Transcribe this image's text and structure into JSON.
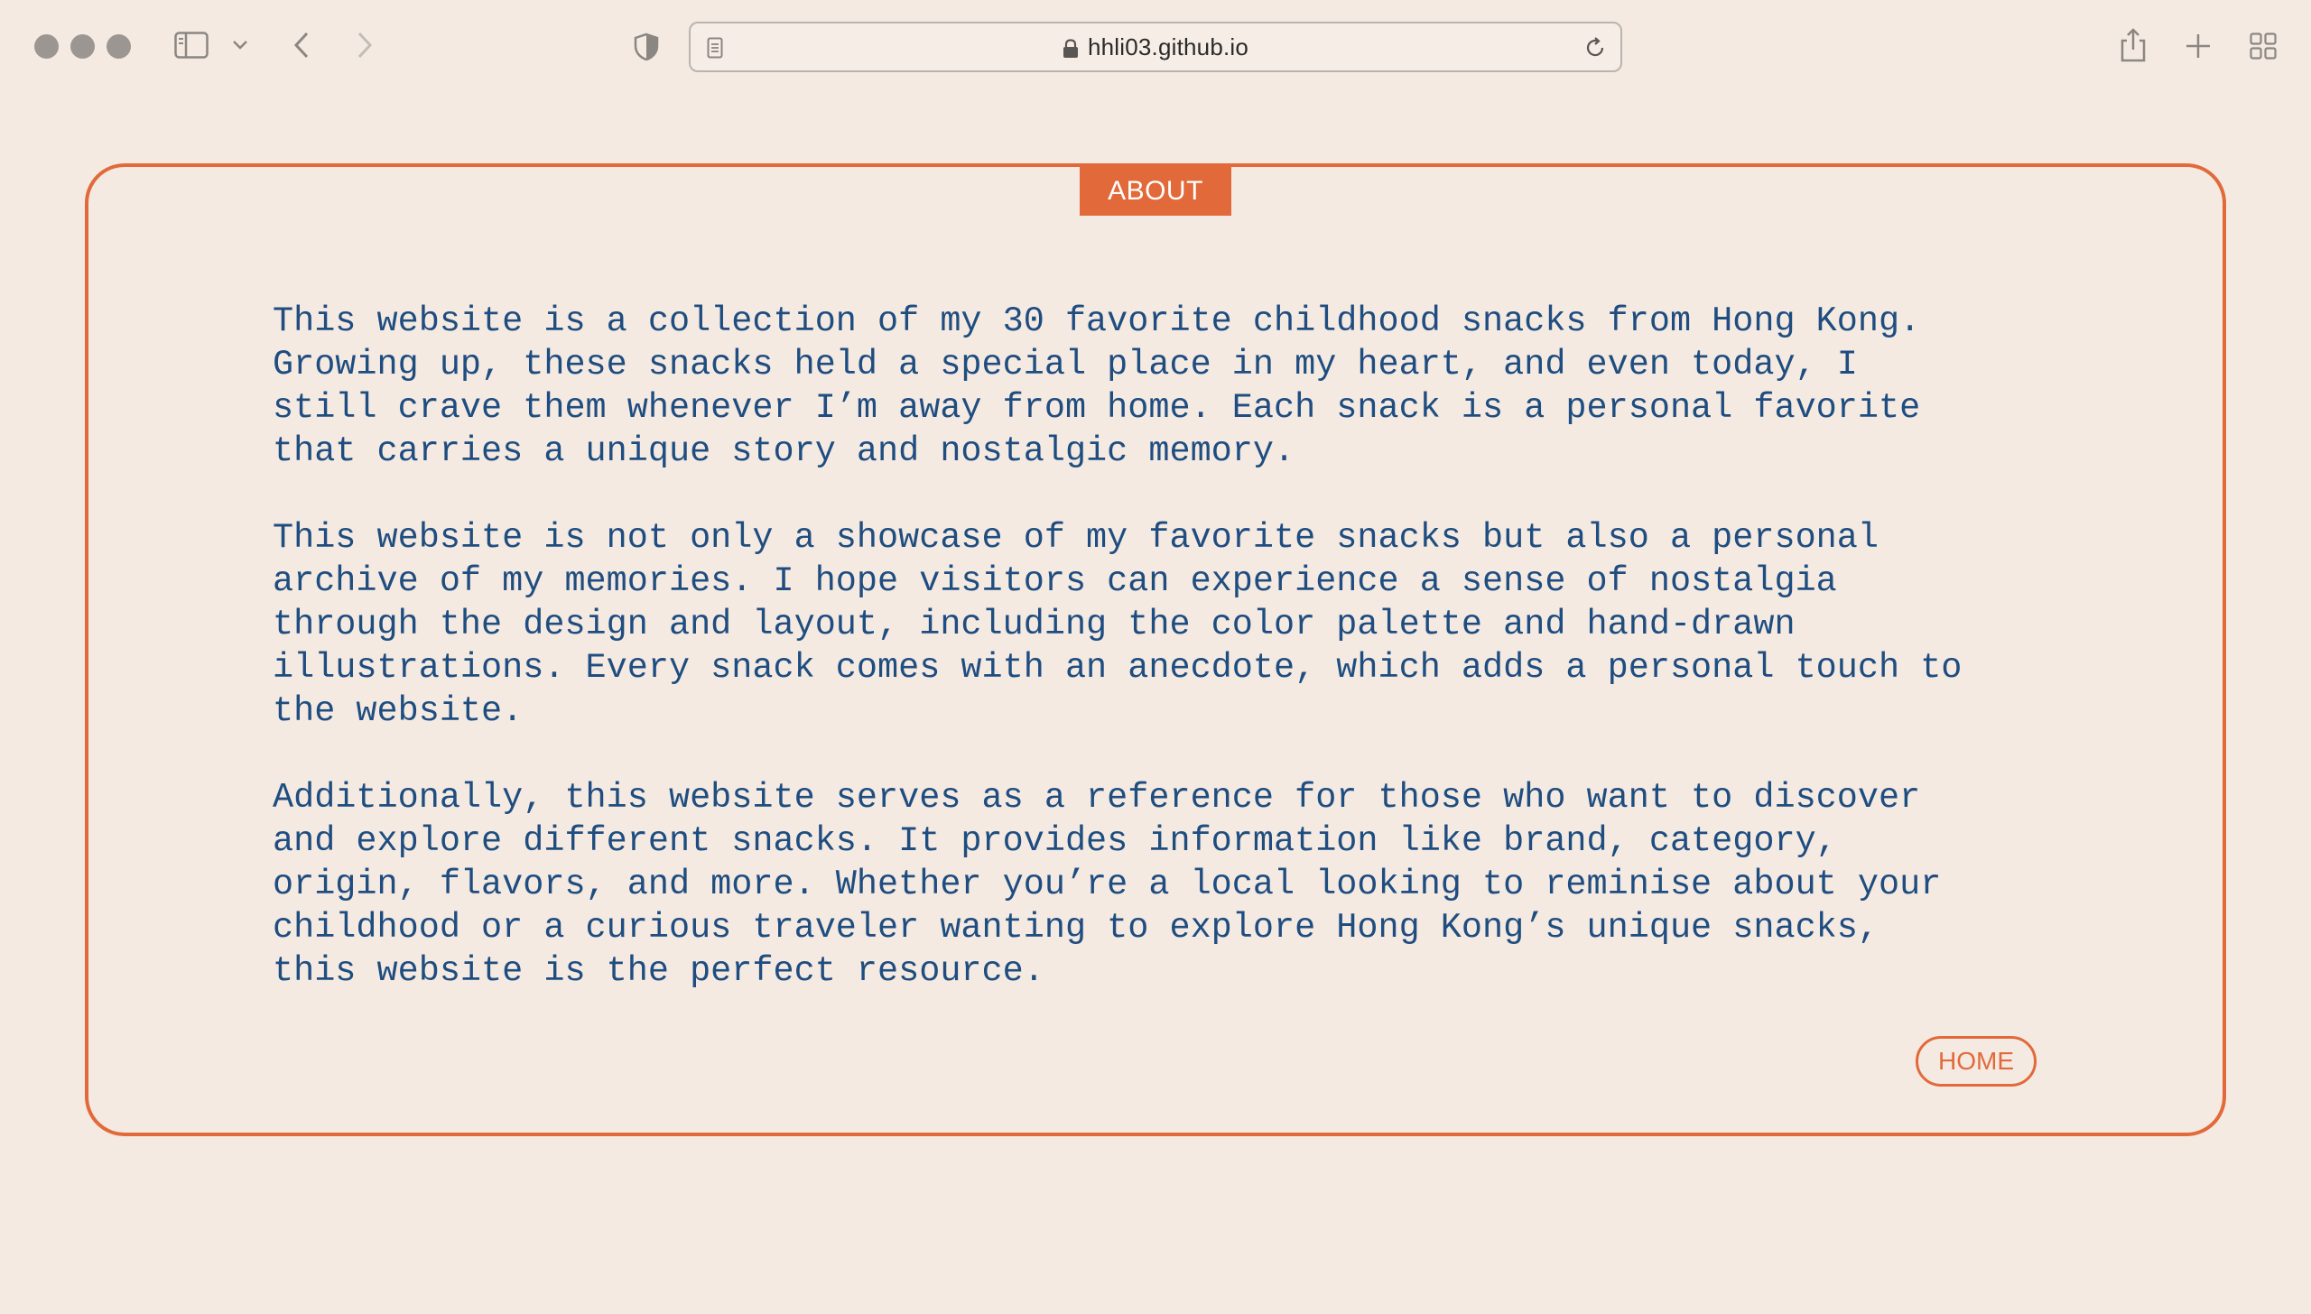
{
  "browser": {
    "url": "hhli03.github.io"
  },
  "page": {
    "section_tag": "ABOUT",
    "paragraphs": [
      "This website is a collection of my 30 favorite childhood snacks from Hong Kong.\nGrowing up, these snacks held a special place in my heart, and even today, I\nstill crave them whenever I’m away from home. Each snack is a personal favorite\nthat carries a unique story and nostalgic memory.",
      "This website is not only a showcase of my favorite snacks but also a personal\narchive of my memories. I hope visitors can experience a sense of nostalgia\nthrough the design and layout, including the color palette and hand-drawn\nillustrations. Every snack comes with an anecdote, which adds a personal touch to\nthe website.",
      "Additionally, this website serves as a reference for those who want to discover\nand explore different snacks. It provides information like brand, category,\norigin, flavors, and more. Whether you’re a local looking to reminise about your\nchildhood or a curious traveler wanting to explore Hong Kong’s unique snacks,\nthis website is the perfect resource."
    ],
    "home_label": "HOME"
  },
  "colors": {
    "background": "#f4eae2",
    "accent": "#e26a3a",
    "text": "#1f4d80"
  }
}
